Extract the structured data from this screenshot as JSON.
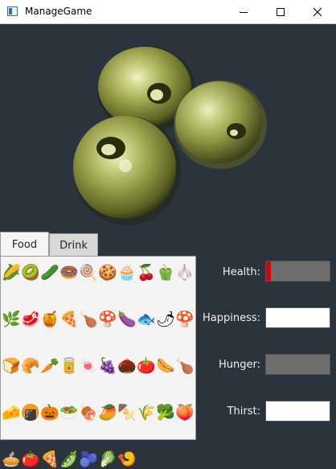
{
  "window": {
    "title": "ManageGame"
  },
  "tabs": [
    {
      "label": "Food",
      "selected": true
    },
    {
      "label": "Drink",
      "selected": false
    }
  ],
  "food_items": [
    {
      "icon": "corn-icon",
      "glyph": "🌽"
    },
    {
      "icon": "kiwi-icon",
      "glyph": "🥝"
    },
    {
      "icon": "cucumber-icon",
      "glyph": "🥒"
    },
    {
      "icon": "donut-icon",
      "glyph": "🍩"
    },
    {
      "icon": "lollipop-icon",
      "glyph": "🍭"
    },
    {
      "icon": "cookie-icon",
      "glyph": "🍪"
    },
    {
      "icon": "cupcake-icon",
      "glyph": "🧁"
    },
    {
      "icon": "cherries-icon",
      "glyph": "🍒"
    },
    {
      "icon": "bell-pepper-icon",
      "glyph": "🫑"
    },
    {
      "icon": "garlic-icon",
      "glyph": "🧄"
    },
    {
      "icon": "leek-icon",
      "glyph": "🌿"
    },
    {
      "icon": "ham-icon",
      "glyph": "🥩"
    },
    {
      "icon": "honey-jar-icon",
      "glyph": "🍯"
    },
    {
      "icon": "pizza-slice-icon",
      "glyph": "🍕"
    },
    {
      "icon": "drumstick-icon",
      "glyph": "🍗"
    },
    {
      "icon": "mushroom-icon",
      "glyph": "🍄"
    },
    {
      "icon": "eggplant-icon",
      "glyph": "🍆"
    },
    {
      "icon": "fish-icon",
      "glyph": "🐟"
    },
    {
      "icon": "chili-icon",
      "glyph": "🌶"
    },
    {
      "icon": "red-mushroom-icon",
      "glyph": "🍄"
    },
    {
      "icon": "bread-icon",
      "glyph": "🍞"
    },
    {
      "icon": "croissant-icon",
      "glyph": "🥐"
    },
    {
      "icon": "carrot-icon",
      "glyph": "🥕"
    },
    {
      "icon": "soup-can-icon",
      "glyph": "🥫"
    },
    {
      "icon": "candy-icon",
      "glyph": "🍬"
    },
    {
      "icon": "grapes-icon",
      "glyph": "🍇"
    },
    {
      "icon": "sea-urchin-icon",
      "glyph": "🌰"
    },
    {
      "icon": "tomato-icon",
      "glyph": "🍅"
    },
    {
      "icon": "sausage-icon",
      "glyph": "🌭"
    },
    {
      "icon": "chicken-leg-icon",
      "glyph": "🍗"
    },
    {
      "icon": "cheese-icon",
      "glyph": "🧀"
    },
    {
      "icon": "cracker-icon",
      "glyph": "🍘"
    },
    {
      "icon": "pumpkin-icon",
      "glyph": "🎃"
    },
    {
      "icon": "salad-bowl-icon",
      "glyph": "🥗"
    },
    {
      "icon": "chicken-plate-icon",
      "glyph": "🍖"
    },
    {
      "icon": "papaya-icon",
      "glyph": "🥭"
    },
    {
      "icon": "kebab-icon",
      "glyph": "🍢"
    },
    {
      "icon": "wheat-icon",
      "glyph": "🌾"
    },
    {
      "icon": "broccoli-icon",
      "glyph": "🥦"
    },
    {
      "icon": "peach-icon",
      "glyph": "🍑"
    },
    {
      "icon": "pie-slice-icon",
      "glyph": "🥧"
    },
    {
      "icon": "tomato-icon",
      "glyph": "🍅"
    },
    {
      "icon": "pizza-icon",
      "glyph": "🍕"
    },
    {
      "icon": "peas-icon",
      "glyph": "🫛"
    },
    {
      "icon": "blueberries-icon",
      "glyph": "🫐"
    },
    {
      "icon": "lettuce-icon",
      "glyph": "🥬"
    },
    {
      "icon": "shrimp-icon",
      "glyph": "🍤"
    }
  ],
  "stats": {
    "health": {
      "label": "Health:",
      "level": 0.08,
      "fill_color": "#e00000",
      "track_color": "#6e6e6e",
      "border_color": "#555555"
    },
    "happiness": {
      "label": "Happiness:",
      "level": 0.0,
      "fill_color": "#ffffff",
      "track_color": "#ffffff",
      "border_color": "#555555"
    },
    "hunger": {
      "label": "Hunger:",
      "level": 1.0,
      "fill_color": "#6e6e6e",
      "track_color": "#6e6e6e",
      "border_color": "#555555"
    },
    "thirst": {
      "label": "Thirst:",
      "level": 0.0,
      "fill_color": "#ffffff",
      "track_color": "#ffffff",
      "border_color": "#555555"
    }
  }
}
